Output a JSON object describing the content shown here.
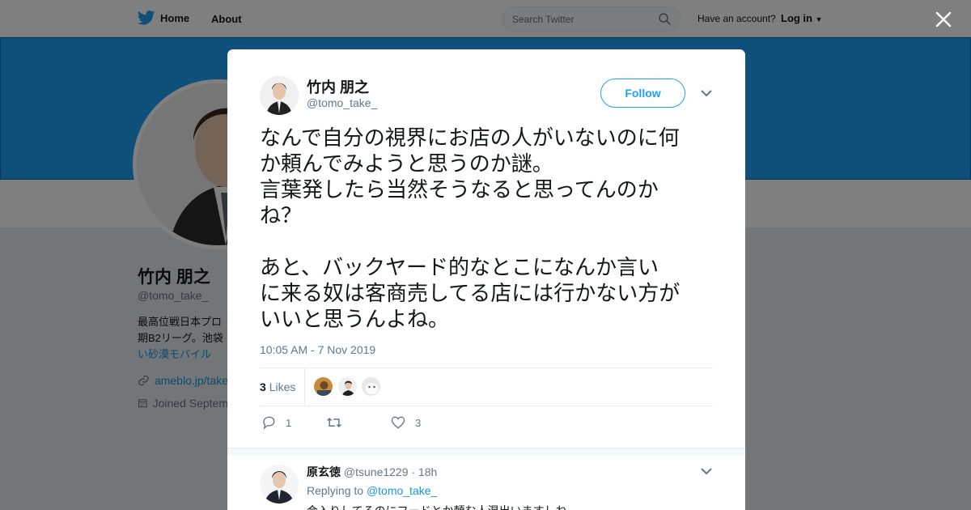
{
  "topbar": {
    "home_label": "Home",
    "about_label": "About",
    "search_placeholder": "Search Twitter",
    "have_account": "Have an account?",
    "login_label": "Log in"
  },
  "profile": {
    "name": "竹内 朋之",
    "handle": "@tomo_take_",
    "bio_line1": "最高位戦日本プロ",
    "bio_line2": "期B2リーグ。池袋",
    "bio_line3": "い砂漠モバイル",
    "link": "ameblo.jp/take",
    "joined": "Joined Septem"
  },
  "tweet": {
    "author_name": "竹内 朋之",
    "author_handle": "@tomo_take_",
    "follow_label": "Follow",
    "text_line1": "なんで自分の視界にお店の人がいないのに何",
    "text_line2": "か頼んでみようと思うのか謎。",
    "text_line3": "言葉発したら当然そうなると思ってんのか",
    "text_line4": "ね？",
    "text_line5": "あと、バックヤード的なとこになんか言い",
    "text_line6": "に来る奴は客商売してる店には行かない方が",
    "text_line7": "いいと思うんよね。",
    "timestamp": "10:05 AM - 7 Nov 2019",
    "likes_count": "3",
    "likes_label": "Likes",
    "reply_count": "1",
    "retweet_count": "",
    "like_count": "3"
  },
  "reply": {
    "name": "原玄徳",
    "handle": "@tsune1229",
    "time": "· 18h",
    "replying_prefix": "Replying to",
    "replying_to": "@tomo_take_",
    "text": "会入りしてるのにフードとか頼む人混出いますしね"
  },
  "colors": {
    "accent": "#1da1f2",
    "link": "#1b95e0",
    "banner": "#1da1f2",
    "muted_text": "#657786"
  },
  "icons": [
    "twitter-bird-icon",
    "search-icon",
    "close-icon",
    "chevron-down-icon",
    "link-icon",
    "calendar-icon",
    "reply-icon",
    "retweet-icon",
    "heart-icon"
  ]
}
